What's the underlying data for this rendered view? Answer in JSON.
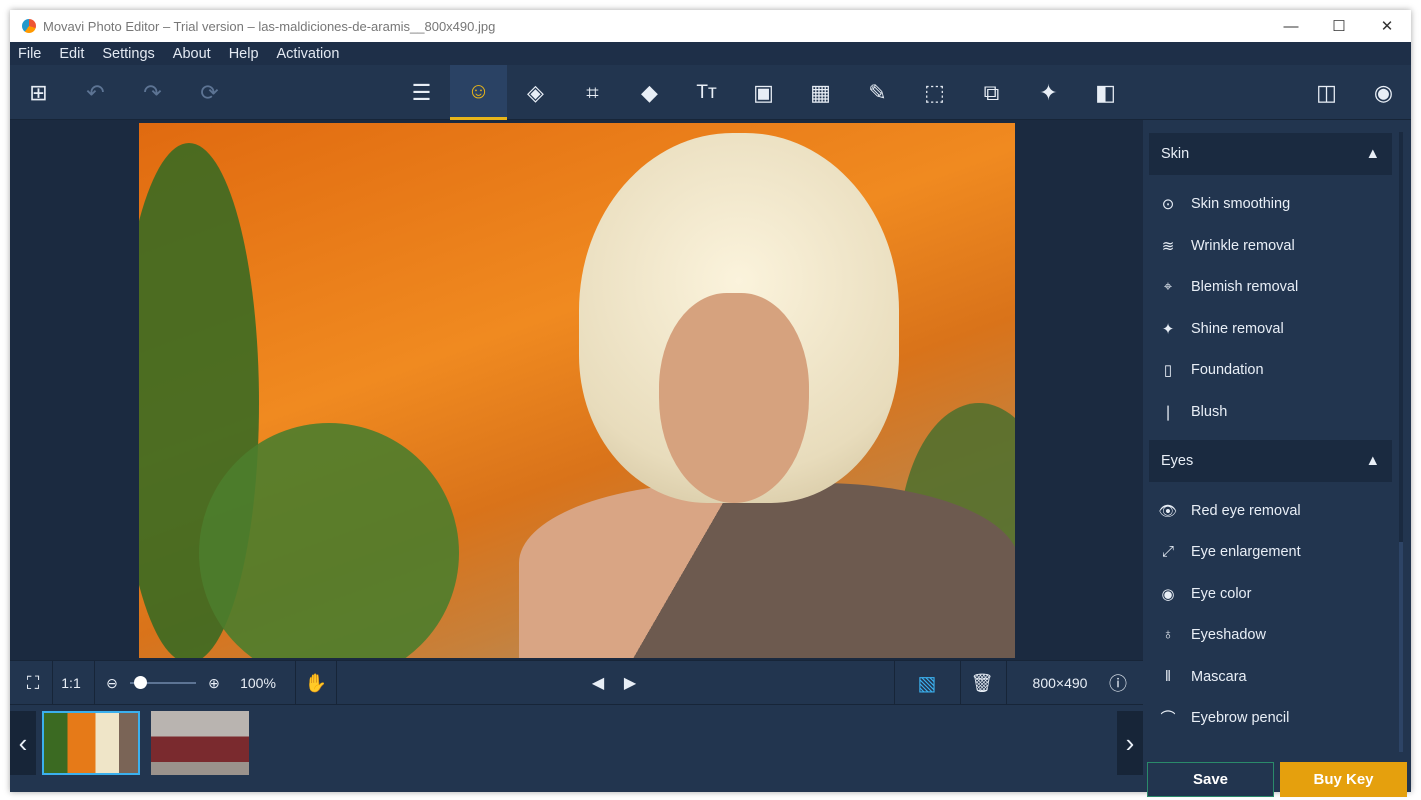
{
  "window": {
    "title": "Movavi Photo Editor – Trial version – las-maldiciones-de-aramis__800x490.jpg",
    "minimize": "—",
    "maximize": "☐",
    "close": "✕"
  },
  "menu": [
    "File",
    "Edit",
    "Settings",
    "About",
    "Help",
    "Activation"
  ],
  "bottom": {
    "fit": "⛶",
    "one_to_one": "1:1",
    "zoom": "100%",
    "dimensions": "800×490"
  },
  "panel": {
    "sections": [
      {
        "title": "Skin",
        "items": [
          "Skin smoothing",
          "Wrinkle removal",
          "Blemish removal",
          "Shine removal",
          "Foundation",
          "Blush"
        ]
      },
      {
        "title": "Eyes",
        "items": [
          "Red eye removal",
          "Eye enlargement",
          "Eye color",
          "Eyeshadow",
          "Mascara",
          "Eyebrow pencil"
        ]
      }
    ]
  },
  "buttons": {
    "save": "Save",
    "buy": "Buy Key"
  },
  "colors": {
    "accent": "#e8b51a",
    "buy": "#e5a00d",
    "save_border": "#2a8a6a"
  }
}
